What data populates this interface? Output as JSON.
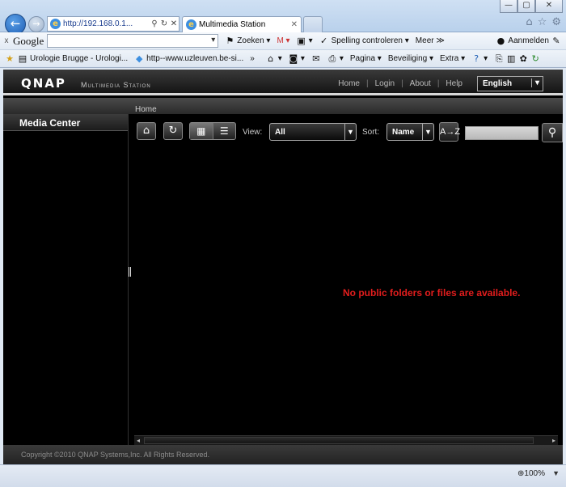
{
  "browser": {
    "address": "http://192.168.0.1...",
    "tab_title": "Multimedia Station",
    "window_buttons": [
      "—",
      "▢",
      "✕"
    ],
    "google_toolbar": {
      "logo": "Google",
      "search_value": "",
      "items": [
        "Zoeken ▾",
        "M ▾",
        "▾",
        "Spelling controleren ▾",
        "Meer ≫",
        "Aanmelden"
      ]
    },
    "favorites_bar": {
      "items": [
        "Urologie Brugge - Urologi...",
        "http--www.uzleuven.be-si...",
        "Pagina ▾",
        "Beveiliging ▾",
        "Extra ▾"
      ]
    },
    "zoom": "100%"
  },
  "app": {
    "logo": "QNAP",
    "subtitle": "Multimedia Station",
    "nav": [
      "Home",
      "Login",
      "About",
      "Help"
    ],
    "language": "English",
    "breadcrumb": "Home",
    "sidebar_title": "Media Center",
    "toolbar": {
      "view_label": "View:",
      "view_value": "All",
      "sort_label": "Sort:",
      "sort_value": "Name",
      "az_label": "A→Z",
      "search_value": ""
    },
    "empty_message": "No public folders or files are available.",
    "copyright": "Copyright ©2010 QNAP Systems,Inc. All Rights Reserved."
  }
}
